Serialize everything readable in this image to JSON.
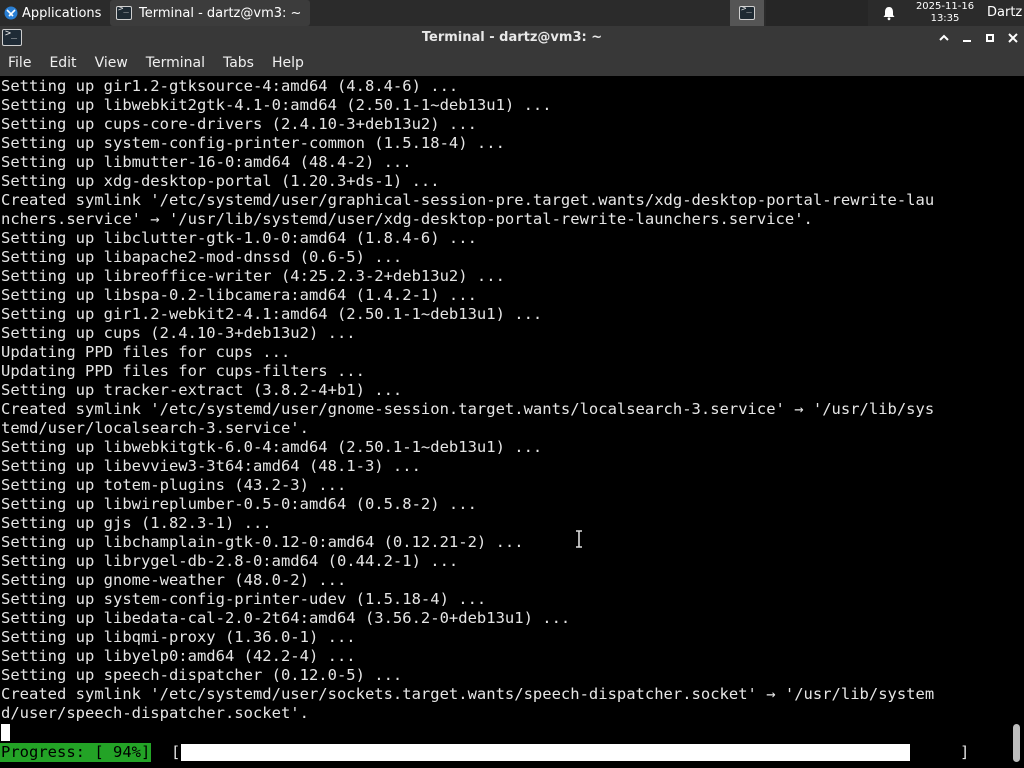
{
  "panel": {
    "apps_label": "Applications",
    "task_title": "Terminal - dartz@vm3: ~",
    "clock_date": "2025-11-16",
    "clock_time": "13:35",
    "user": "Dartz"
  },
  "window": {
    "title": "Terminal - dartz@vm3: ~"
  },
  "menu": [
    "File",
    "Edit",
    "View",
    "Terminal",
    "Tabs",
    "Help"
  ],
  "terminal": {
    "lines": [
      "Setting up gir1.2-gtksource-4:amd64 (4.8.4-6) ...",
      "Setting up libwebkit2gtk-4.1-0:amd64 (2.50.1-1~deb13u1) ...",
      "Setting up cups-core-drivers (2.4.10-3+deb13u2) ...",
      "Setting up system-config-printer-common (1.5.18-4) ...",
      "Setting up libmutter-16-0:amd64 (48.4-2) ...",
      "Setting up xdg-desktop-portal (1.20.3+ds-1) ...",
      "Created symlink '/etc/systemd/user/graphical-session-pre.target.wants/xdg-desktop-portal-rewrite-lau",
      "nchers.service' → '/usr/lib/systemd/user/xdg-desktop-portal-rewrite-launchers.service'.",
      "Setting up libclutter-gtk-1.0-0:amd64 (1.8.4-6) ...",
      "Setting up libapache2-mod-dnssd (0.6-5) ...",
      "Setting up libreoffice-writer (4:25.2.3-2+deb13u2) ...",
      "Setting up libspa-0.2-libcamera:amd64 (1.4.2-1) ...",
      "Setting up gir1.2-webkit2-4.1:amd64 (2.50.1-1~deb13u1) ...",
      "Setting up cups (2.4.10-3+deb13u2) ...",
      "Updating PPD files for cups ...",
      "Updating PPD files for cups-filters ...",
      "Setting up tracker-extract (3.8.2-4+b1) ...",
      "Created symlink '/etc/systemd/user/gnome-session.target.wants/localsearch-3.service' → '/usr/lib/sys",
      "temd/user/localsearch-3.service'.",
      "Setting up libwebkitgtk-6.0-4:amd64 (2.50.1-1~deb13u1) ...",
      "Setting up libevview3-3t64:amd64 (48.1-3) ...",
      "Setting up totem-plugins (43.2-3) ...",
      "Setting up libwireplumber-0.5-0:amd64 (0.5.8-2) ...",
      "Setting up gjs (1.82.3-1) ...",
      "Setting up libchamplain-gtk-0.12-0:amd64 (0.12.21-2) ...",
      "Setting up librygel-db-2.8-0:amd64 (0.44.2-1) ...",
      "Setting up gnome-weather (48.0-2) ...",
      "Setting up system-config-printer-udev (1.5.18-4) ...",
      "Setting up libedata-cal-2.0-2t64:amd64 (3.56.2-0+deb13u1) ...",
      "Setting up libqmi-proxy (1.36.0-1) ...",
      "Setting up libyelp0:amd64 (42.2-4) ...",
      "Setting up speech-dispatcher (0.12.0-5) ...",
      "Created symlink '/etc/systemd/user/sockets.target.wants/speech-dispatcher.socket' → '/usr/lib/system",
      "d/user/speech-dispatcher.socket'."
    ],
    "progress_label": "Progress: [ 94%]",
    "progress_fraction": 0.94,
    "bracket_left": "[",
    "bracket_right": "]"
  },
  "colors": {
    "progress_green": "#23a326",
    "panel_bg": "#2b2b2b",
    "titlebar_bg": "#383838"
  }
}
